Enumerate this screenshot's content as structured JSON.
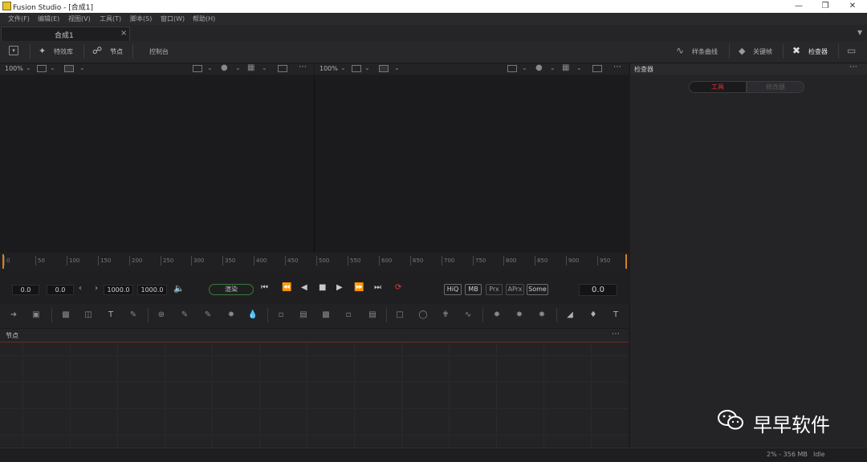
{
  "window": {
    "title": "Fusion Studio - [合成1]"
  },
  "menu": [
    "文件(F)",
    "编辑(E)",
    "视图(V)",
    "工具(T)",
    "脚本(S)",
    "窗口(W)",
    "帮助(H)"
  ],
  "doc_tab": {
    "label": "合成1",
    "close": "×"
  },
  "toolbar": {
    "effects_label": "特效库",
    "nodes_label": "节点",
    "console_label": "控制台",
    "spline_label": "样条曲线",
    "keyframes_label": "关键帧",
    "inspector_label": "检查器"
  },
  "viewer_left": {
    "zoom": "100%"
  },
  "viewer_right": {
    "zoom": "100%"
  },
  "inspector": {
    "title": "检查器",
    "tab_tools": "工具",
    "tab_modifiers": "修改器"
  },
  "ruler": {
    "labels": [
      "0",
      "50",
      "100",
      "150",
      "200",
      "250",
      "300",
      "350",
      "400",
      "450",
      "500",
      "550",
      "600",
      "650",
      "700",
      "750",
      "800",
      "850",
      "900",
      "950"
    ]
  },
  "transport": {
    "global_start": "0.0",
    "render_start": "0.0",
    "render_end": "1000.0",
    "global_end": "1000.0",
    "render_label": "渲染",
    "hiq": "HiQ",
    "mb": "MB",
    "prx": "Prx",
    "aprx": "APrx",
    "some": "Some",
    "current_time": "0.0"
  },
  "nodes_panel": {
    "title": "节点"
  },
  "status": {
    "memory": "2% - 356 MB",
    "state": "Idle"
  },
  "watermark": {
    "text": "早早软件"
  },
  "colors": {
    "accent_red": "#e03030",
    "loop_red": "#e04040",
    "render_green": "#3a7a3a",
    "orange_marker": "#d08020"
  }
}
